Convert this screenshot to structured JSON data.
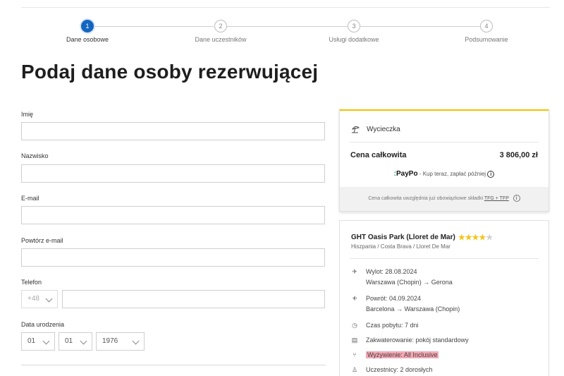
{
  "stepper": {
    "steps": [
      {
        "number": "1",
        "label": "Dane osobowe",
        "active": true
      },
      {
        "number": "2",
        "label": "Dane uczestników",
        "active": false
      },
      {
        "number": "3",
        "label": "Usługi dodatkowe",
        "active": false
      },
      {
        "number": "4",
        "label": "Podsumowanie",
        "active": false
      }
    ]
  },
  "page_title": "Podaj dane osoby rezerwującej",
  "form": {
    "first_name_label": "Imię",
    "last_name_label": "Nazwisko",
    "email_label": "E-mail",
    "email_repeat_label": "Powtórz e-mail",
    "phone_label": "Telefon",
    "phone_prefix": "+48",
    "birthdate_label": "Data urodzenia",
    "birth_day": "01",
    "birth_month": "01",
    "birth_year": "1976"
  },
  "price_card": {
    "trip_label": "Wycieczka",
    "total_label": "Cena całkowita",
    "total_value": "3 806,00 zł",
    "paypo_brand": "PayPo",
    "paypo_text": "- Kup teraz, zapłać później",
    "footer_text": "Cena całkowita uwzględnia już obowiązkowe składki",
    "footer_link": "TFG + TFP"
  },
  "hotel": {
    "name": "GHT Oasis Park (Lloret de Mar)",
    "stars_on": 4,
    "stars_total": 5,
    "location": "Hiszpania / Costa Brava / Lloret De Mar",
    "departure": "Wylot: 28.08.2024",
    "departure_route": "Warszawa (Chopin) → Gerona",
    "return": "Powrót: 04.09.2024",
    "return_route": "Barcelona → Warszawa (Chopin)",
    "duration": "Czas pobytu: 7 dni",
    "accommodation": "Zakwaterowanie: pokój standardowy",
    "board": "Wyżywienie: All Inclusive",
    "participants": "Uczestnicy: 2 dorosłych"
  },
  "colors": {
    "accent": "#1565c0",
    "card_top_border": "#f2c200",
    "highlight": "#f4a8b4"
  }
}
